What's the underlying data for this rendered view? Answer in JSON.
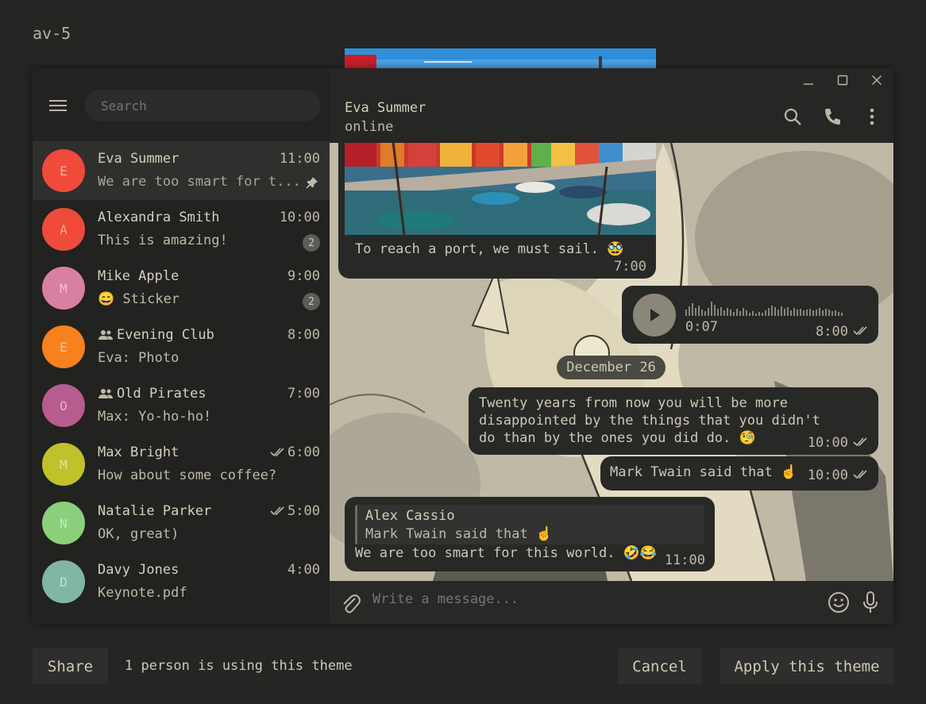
{
  "theme_name": "av-5",
  "sidebar": {
    "search_placeholder": "Search",
    "chats": [
      {
        "initial": "E",
        "name": "Eva Summer",
        "time": "11:00",
        "preview": "We are too smart for t...",
        "color": "#f04a3a",
        "pinned": true,
        "group": false,
        "read": false,
        "badge": ""
      },
      {
        "initial": "A",
        "name": "Alexandra Smith",
        "time": "10:00",
        "preview": "This is amazing!",
        "color": "#f04a3a",
        "pinned": false,
        "group": false,
        "read": false,
        "badge": "2"
      },
      {
        "initial": "M",
        "name": "Mike Apple",
        "time": "9:00",
        "preview": "😄 Sticker",
        "color": "#d97fa1",
        "pinned": false,
        "group": false,
        "read": false,
        "badge": "2"
      },
      {
        "initial": "E",
        "name": "Evening Club",
        "time": "8:00",
        "preview": "Eva: Photo",
        "color": "#f7811d",
        "pinned": false,
        "group": true,
        "read": false,
        "badge": ""
      },
      {
        "initial": "O",
        "name": "Old Pirates",
        "time": "7:00",
        "preview": "Max: Yo-ho-ho!",
        "color": "#b75c8f",
        "pinned": false,
        "group": true,
        "read": false,
        "badge": ""
      },
      {
        "initial": "M",
        "name": "Max Bright",
        "time": "6:00",
        "preview": "How about some coffee?",
        "color": "#c0c12b",
        "pinned": false,
        "group": false,
        "read": true,
        "badge": ""
      },
      {
        "initial": "N",
        "name": "Natalie Parker",
        "time": "5:00",
        "preview": "OK, great)",
        "color": "#8ccf7a",
        "pinned": false,
        "group": false,
        "read": true,
        "badge": ""
      },
      {
        "initial": "D",
        "name": "Davy Jones",
        "time": "4:00",
        "preview": "Keynote.pdf",
        "color": "#7fb7a4",
        "pinned": false,
        "group": false,
        "read": false,
        "badge": ""
      }
    ]
  },
  "chat_header": {
    "name": "Eva Summer",
    "status": "online"
  },
  "messages": {
    "photo_caption": "To reach a port, we must sail. 🥸",
    "photo_time": "7:00",
    "voice_duration": "0:07",
    "voice_time": "8:00",
    "date_separator": "December 26",
    "quote_text": "Twenty years from now you will be more disappointed by the things that you didn't do than by the ones you did do. 🧐",
    "quote_time": "10:00",
    "twain_text": "Mark Twain said that ☝️",
    "twain_time": "10:00",
    "reply_name": "Alex Cassio",
    "reply_quote": "Mark Twain said that ☝️",
    "reply_text": "We are too smart for this world. 🤣😂",
    "reply_time": "11:00"
  },
  "composer": {
    "placeholder": "Write a message..."
  },
  "footer": {
    "share_label": "Share",
    "note": "1 person is using this theme",
    "cancel_label": "Cancel",
    "apply_label": "Apply this theme"
  },
  "colors": {
    "background": "#252523",
    "bubble": "#282827",
    "text": "#cfc8b6",
    "badge": "#5c5c59"
  }
}
